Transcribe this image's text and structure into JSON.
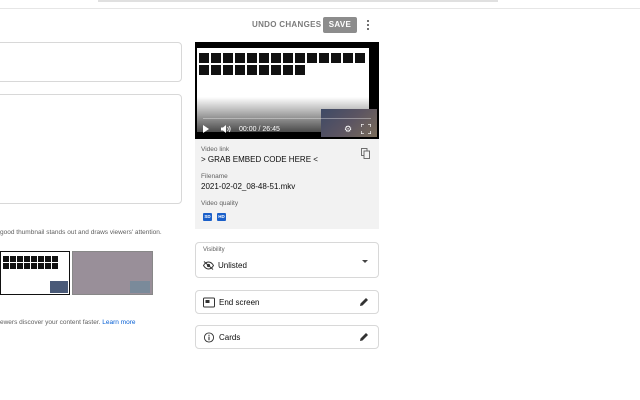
{
  "toolbar": {
    "undo_label": "UNDO CHANGES",
    "save_label": "SAVE",
    "more_icon": "more-vert-icon"
  },
  "left": {
    "thumbnail_hint": "good thumbnail stands out and draws viewers' attention.",
    "tags_hint": "ewers discover your content faster.",
    "learn_more": "Learn more"
  },
  "player": {
    "time": "00:00 / 26:45",
    "play_icon": "play-icon",
    "volume_icon": "volume-icon",
    "settings_icon": "gear-icon",
    "fullscreen_icon": "fullscreen-icon"
  },
  "details": {
    "video_link_label": "Video link",
    "video_link_value": "> GRAB EMBED CODE HERE <",
    "filename_label": "Filename",
    "filename_value": "2021-02-02_08-48-51.mkv",
    "quality_label": "Video quality",
    "quality_badges": [
      "SD",
      "HD"
    ],
    "badge_color": "#1a5fc9"
  },
  "visibility": {
    "label": "Visibility",
    "value": "Unlisted"
  },
  "end_screen": {
    "label": "End screen"
  },
  "cards": {
    "label": "Cards"
  }
}
